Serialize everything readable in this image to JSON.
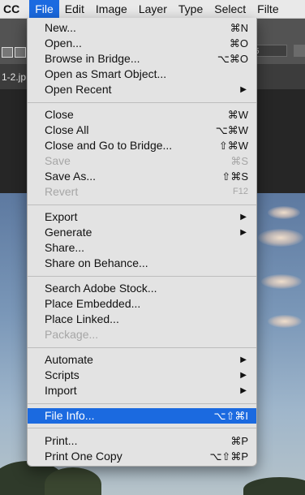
{
  "menubar": {
    "app": "CC",
    "items": [
      "File",
      "Edit",
      "Image",
      "Layer",
      "Type",
      "Select",
      "Filte"
    ],
    "active_index": 0
  },
  "options_bar": {
    "field_value": "5"
  },
  "document_tab": {
    "label": "1-2.jp"
  },
  "file_menu": {
    "groups": [
      [
        {
          "label": "New...",
          "shortcut": "⌘N"
        },
        {
          "label": "Open...",
          "shortcut": "⌘O"
        },
        {
          "label": "Browse in Bridge...",
          "shortcut": "⌥⌘O"
        },
        {
          "label": "Open as Smart Object...",
          "shortcut": ""
        },
        {
          "label": "Open Recent",
          "shortcut": "",
          "submenu": true
        }
      ],
      [
        {
          "label": "Close",
          "shortcut": "⌘W"
        },
        {
          "label": "Close All",
          "shortcut": "⌥⌘W"
        },
        {
          "label": "Close and Go to Bridge...",
          "shortcut": "⇧⌘W"
        },
        {
          "label": "Save",
          "shortcut": "⌘S",
          "disabled": true
        },
        {
          "label": "Save As...",
          "shortcut": "⇧⌘S"
        },
        {
          "label": "Revert",
          "shortcut": "F12",
          "disabled": true
        }
      ],
      [
        {
          "label": "Export",
          "shortcut": "",
          "submenu": true
        },
        {
          "label": "Generate",
          "shortcut": "",
          "submenu": true
        },
        {
          "label": "Share...",
          "shortcut": ""
        },
        {
          "label": "Share on Behance...",
          "shortcut": ""
        }
      ],
      [
        {
          "label": "Search Adobe Stock...",
          "shortcut": ""
        },
        {
          "label": "Place Embedded...",
          "shortcut": ""
        },
        {
          "label": "Place Linked...",
          "shortcut": ""
        },
        {
          "label": "Package...",
          "shortcut": "",
          "disabled": true
        }
      ],
      [
        {
          "label": "Automate",
          "shortcut": "",
          "submenu": true
        },
        {
          "label": "Scripts",
          "shortcut": "",
          "submenu": true
        },
        {
          "label": "Import",
          "shortcut": "",
          "submenu": true
        }
      ],
      [
        {
          "label": "File Info...",
          "shortcut": "⌥⇧⌘I",
          "highlighted": true
        }
      ],
      [
        {
          "label": "Print...",
          "shortcut": "⌘P"
        },
        {
          "label": "Print One Copy",
          "shortcut": "⌥⇧⌘P"
        }
      ]
    ],
    "submenu_arrow_icon": "triangle-right-icon"
  },
  "colors": {
    "highlight": "#1b6ae0",
    "menu_bg": "#e3e3e3",
    "disabled_text": "#a6a6a6"
  }
}
